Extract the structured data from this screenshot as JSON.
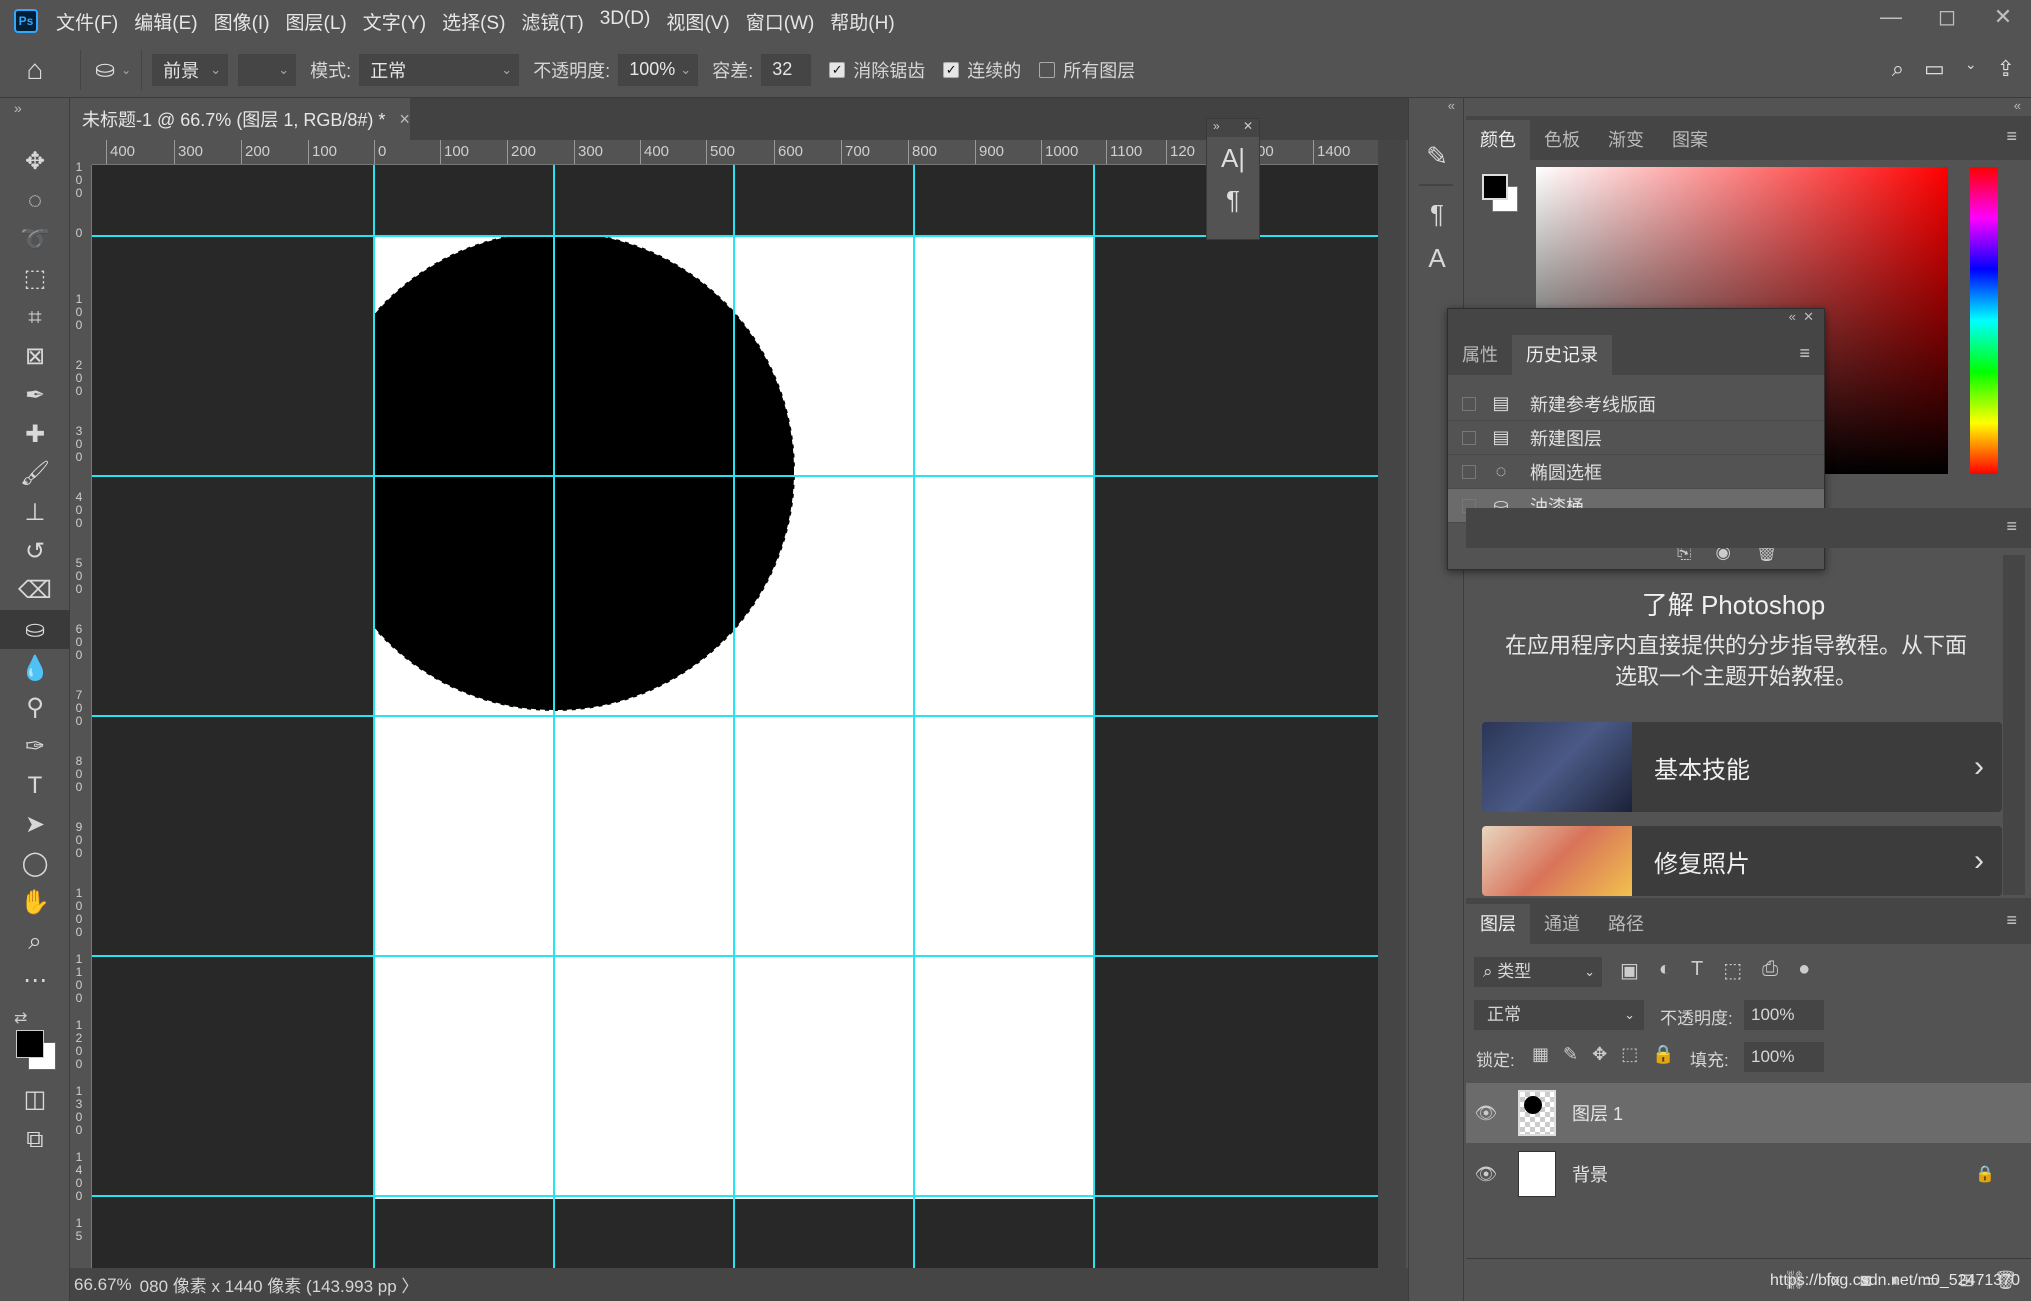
{
  "app": {
    "logo": "Ps"
  },
  "menu": [
    "文件(F)",
    "编辑(E)",
    "图像(I)",
    "图层(L)",
    "文字(Y)",
    "选择(S)",
    "滤镜(T)",
    "3D(D)",
    "视图(V)",
    "窗口(W)",
    "帮助(H)"
  ],
  "window_controls": {
    "minimize": "—",
    "restore": "◻",
    "close": "✕"
  },
  "options": {
    "fill_source": "前景",
    "mode_label": "模式:",
    "mode_value": "正常",
    "opacity_label": "不透明度:",
    "opacity_value": "100%",
    "tolerance_label": "容差:",
    "tolerance_value": "32",
    "anti_alias_label": "消除锯齿",
    "anti_alias_checked": true,
    "contiguous_label": "连续的",
    "contiguous_checked": true,
    "all_layers_label": "所有图层",
    "all_layers_checked": false
  },
  "document": {
    "tab_title": "未标题-1 @ 66.7% (图层 1, RGB/8#) *",
    "close": "×",
    "zoom": "66.67%",
    "size_info": "080 像素 x 1440 像素 (143.993 pp 〉"
  },
  "ruler_top_ticks": [
    "400",
    "300",
    "200",
    "100",
    "0",
    "100",
    "200",
    "300",
    "400",
    "500",
    "600",
    "700",
    "800",
    "900",
    "1000",
    "1100",
    "120",
    "00",
    "1400"
  ],
  "ruler_left_ticks": [
    "1 0 0",
    "0",
    "1 0 0",
    "2 0 0",
    "3 0 0",
    "4 0 0",
    "5 0 0",
    "6 0 0",
    "7 0 0",
    "8 0 0",
    "9 0 0",
    "1 0 0 0",
    "1 1 0 0",
    "1 2 0 0",
    "1 3 0 0",
    "1 4 0 0",
    "1 5"
  ],
  "tools": [
    "move-icon",
    "ellipse-marquee-icon",
    "lasso-icon",
    "object-select-icon",
    "crop-icon",
    "frame-icon",
    "eyedropper-icon",
    "healing-icon",
    "brush-icon",
    "stamp-icon",
    "history-brush-icon",
    "eraser-icon",
    "paint-bucket-icon",
    "blur-icon",
    "dodge-icon",
    "pen-icon",
    "type-icon",
    "path-select-icon",
    "ellipse-shape-icon",
    "hand-icon",
    "zoom-icon",
    "more-icon"
  ],
  "char_panel": {
    "type_glyph": "A|",
    "para_glyph": "¶"
  },
  "color_panel": {
    "tabs": [
      "颜色",
      "色板",
      "渐变",
      "图案"
    ],
    "foreground": "#000000",
    "background": "#ffffff"
  },
  "history_panel": {
    "tabs": [
      "属性",
      "历史记录"
    ],
    "items": [
      {
        "label": "新建参考线版面",
        "icon": "doc-icon"
      },
      {
        "label": "新建图层",
        "icon": "doc-icon"
      },
      {
        "label": "椭圆选框",
        "icon": "ellipse-select-icon"
      },
      {
        "label": "油漆桶",
        "icon": "paint-bucket-icon"
      }
    ]
  },
  "learn_panel": {
    "title": "了解 Photoshop",
    "description": "在应用程序内直接提供的分步指导教程。从下面选取一个主题开始教程。",
    "cards": [
      {
        "title": "基本技能"
      },
      {
        "title": "修复照片"
      }
    ]
  },
  "layers_panel": {
    "tabs": [
      "图层",
      "通道",
      "路径"
    ],
    "filter_label": "类型",
    "blend_mode": "正常",
    "opacity_label": "不透明度:",
    "opacity_value": "100%",
    "lock_label": "锁定:",
    "fill_label": "填充:",
    "fill_value": "100%",
    "layers": [
      {
        "name": "图层 1",
        "selected": true
      },
      {
        "name": "背景",
        "locked": true
      }
    ],
    "footer_text": "https://blog.csdn.net/m0_52471370"
  }
}
